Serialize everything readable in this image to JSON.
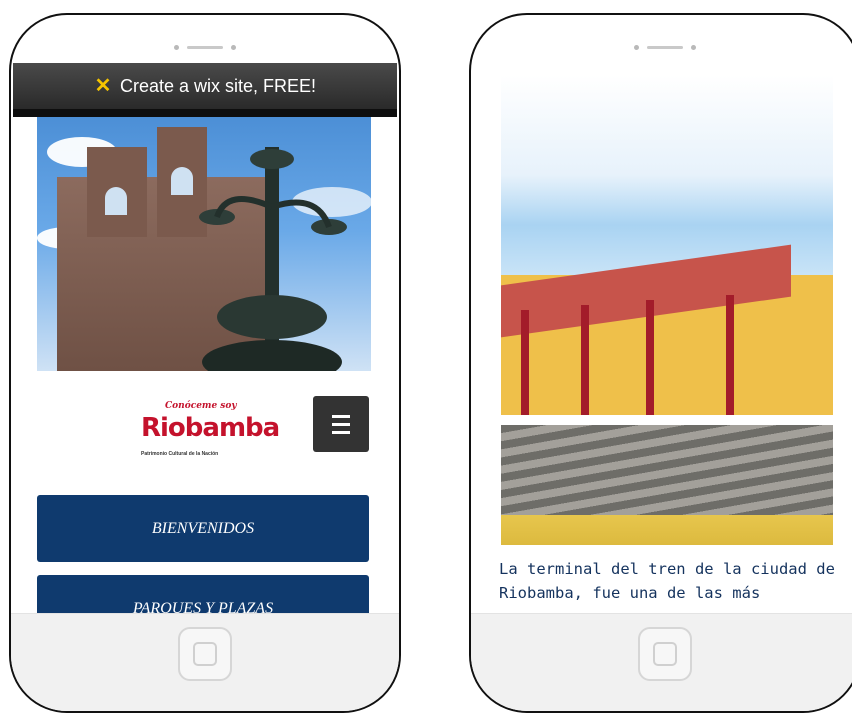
{
  "left_phone": {
    "wix_banner": {
      "text": "Create a wix site, FREE!"
    },
    "logo": {
      "small_text": "Conóceme soy",
      "brand": "Riobamba",
      "tagline": "Patrimonio Cultural de la Nación"
    },
    "nav": [
      {
        "label": "BIENVENIDOS"
      },
      {
        "label": "PARQUES Y PLAZAS"
      }
    ]
  },
  "right_phone": {
    "caption": "La terminal del tren de la ciudad de Riobamba, fue una de las más"
  },
  "colors": {
    "nav_bg": "#0f3a6e",
    "menu_button_bg": "#333333",
    "wix_bar": "#2a2a2a",
    "caption_text": "#15335e",
    "logo_red": "#c4122c"
  }
}
